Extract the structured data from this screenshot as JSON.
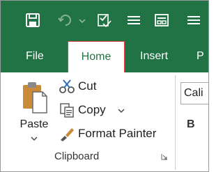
{
  "quick_access": {
    "icons": [
      "save-icon",
      "undo-icon",
      "dropdown-arrow-icon",
      "spelling-check-icon",
      "align-icon",
      "form-icon",
      "align-icon"
    ]
  },
  "tabs": [
    {
      "label": "File",
      "active": false
    },
    {
      "label": "Home",
      "active": true
    },
    {
      "label": "Insert",
      "active": false
    },
    {
      "label": "P",
      "active": false
    }
  ],
  "clipboard": {
    "paste_label": "Paste",
    "cut_label": "Cut",
    "copy_label": "Copy",
    "format_painter_label": "Format Painter",
    "group_label": "Clipboard"
  },
  "font": {
    "name_value": "Cali",
    "bold_label": "B"
  },
  "colors": {
    "ribbon_green": "#217346",
    "active_tab_border": "#e0413b",
    "tab_text": "#ffffff"
  }
}
